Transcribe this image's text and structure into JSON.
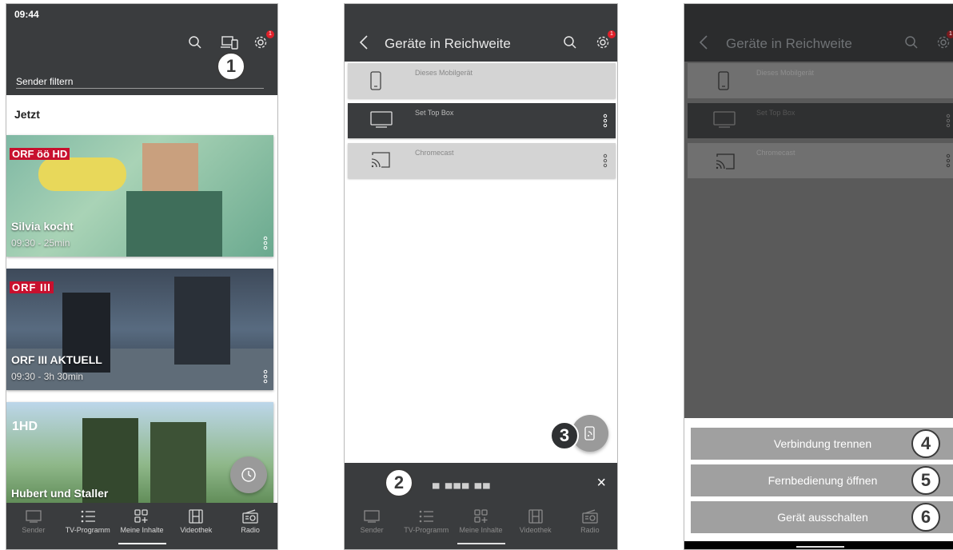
{
  "phone1": {
    "status_time": "09:44",
    "filter_placeholder": "Sender filtern",
    "settings_badge": "1",
    "section_title": "Jetzt",
    "callout": "1",
    "cards": [
      {
        "logo": "ORF öö HD",
        "title": "Silvia kocht",
        "time": "09:30 - 25min"
      },
      {
        "logo": "ORF III",
        "title": "ORF III AKTUELL",
        "time": "09:30 - 3h 30min"
      },
      {
        "logo": "1HD",
        "title": "Hubert und Staller",
        "time": ""
      }
    ],
    "nav": [
      "Sender",
      "TV-Programm",
      "Meine Inhalte",
      "Videothek",
      "Radio"
    ]
  },
  "phone2": {
    "title": "Geräte in Reichweite",
    "settings_badge": "1",
    "devices": [
      {
        "name": "Dieses Mobilgerät",
        "icon": "phone-icon"
      },
      {
        "name": "Set Top Box",
        "icon": "tv-icon"
      },
      {
        "name": "Chromecast",
        "icon": "cast-icon"
      }
    ],
    "connected_name": "▄ ▄▄▄ ▄▄",
    "close_symbol": "×",
    "callout_bar": "2",
    "callout_fab": "3",
    "nav": [
      "Sender",
      "TV-Programm",
      "Meine Inhalte",
      "Videothek",
      "Radio"
    ]
  },
  "phone3": {
    "title": "Geräte in Reichweite",
    "settings_badge": "1",
    "devices": [
      "Dieses Mobilgerät",
      "Set Top Box",
      "Chromecast"
    ],
    "actions": [
      {
        "label": "Verbindung trennen",
        "callout": "4"
      },
      {
        "label": "Fernbedienung öffnen",
        "callout": "5"
      },
      {
        "label": "Gerät ausschalten",
        "callout": "6"
      }
    ]
  },
  "colors": {
    "dark": "#3a3c3e",
    "badge": "#e0202a",
    "row": "#d4d4d4",
    "action": "#a0a0a0"
  }
}
